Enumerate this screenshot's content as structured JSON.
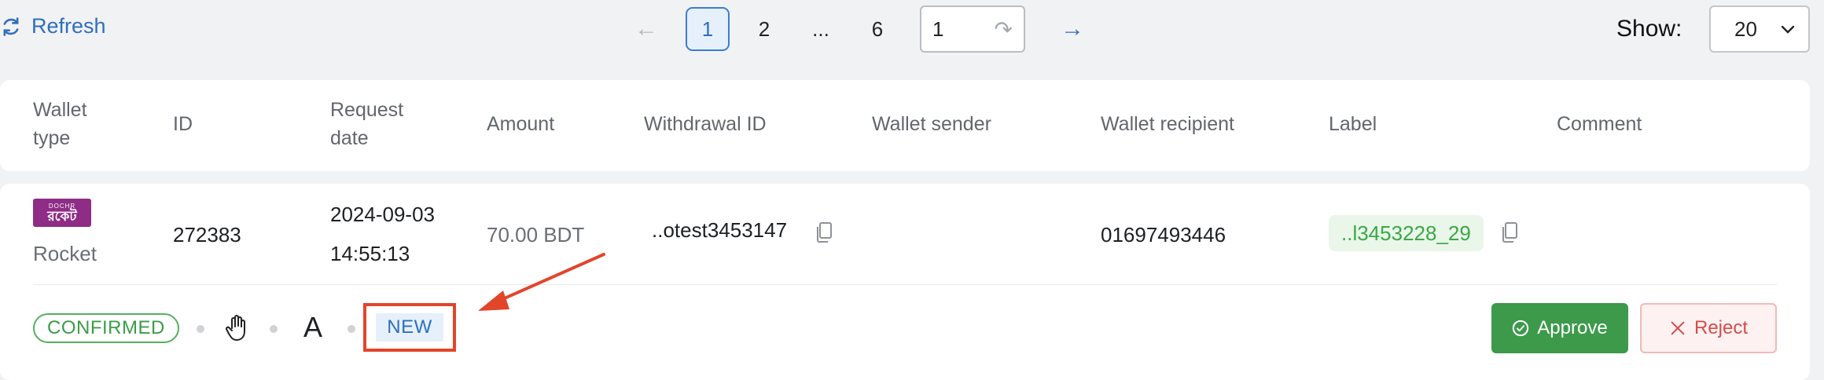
{
  "toolbar": {
    "refresh_label": "Refresh",
    "pagination": {
      "pages": [
        "1",
        "2",
        "...",
        "6"
      ],
      "current": "1",
      "goto_value": "1"
    },
    "show_label": "Show:",
    "show_value": "20"
  },
  "table": {
    "headers": {
      "wallet_type": "Wallet type",
      "id": "ID",
      "request_date": "Request date",
      "amount": "Amount",
      "withdrawal_id": "Withdrawal ID",
      "wallet_sender": "Wallet sender",
      "wallet_recipient": "Wallet recipient",
      "label": "Label",
      "comment": "Comment"
    },
    "row": {
      "wallet_logo_top": "DOCHR",
      "wallet_logo_main": "রকেট",
      "wallet_type": "Rocket",
      "id": "272383",
      "request_date": "2024-09-03",
      "request_time": "14:55:13",
      "amount": "70.00 BDT",
      "withdrawal_id": "..otest3453147",
      "wallet_recipient": "01697493446",
      "label": "..l3453228_29",
      "status": "CONFIRMED",
      "method_letter": "A",
      "new_badge": "NEW",
      "approve_label": "Approve",
      "reject_label": "Reject"
    }
  },
  "colors": {
    "accent": "#2f6fbd",
    "success": "#3c9a4a",
    "danger": "#d64b4b",
    "highlight": "#e2452a"
  }
}
